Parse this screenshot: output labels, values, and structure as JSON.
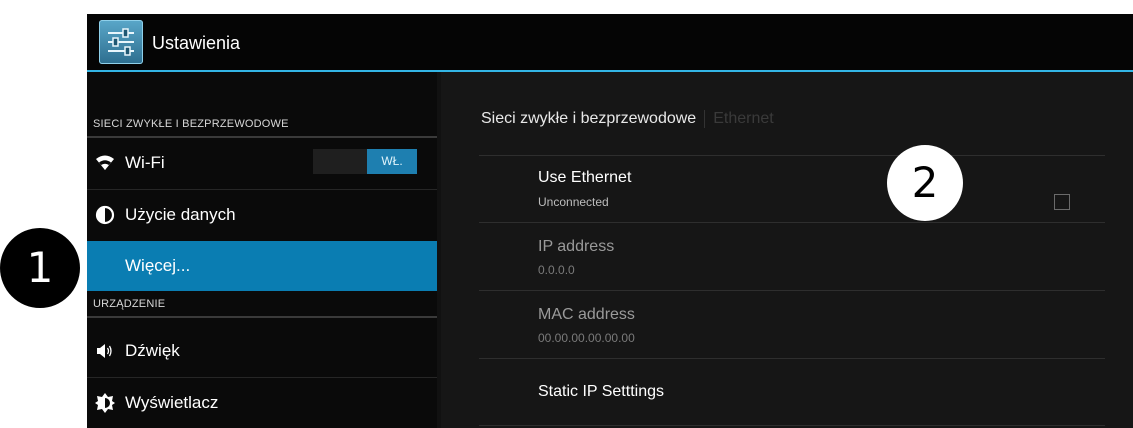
{
  "action_bar": {
    "title": "Ustawienia",
    "icon": "settings-sliders-icon"
  },
  "left_pane": {
    "sections": [
      {
        "header": "SIECI ZWYKŁE I BEZPRZEWODOWE",
        "items": [
          {
            "label": "Wi-Fi",
            "icon": "wifi-icon",
            "toggle": "WŁ."
          },
          {
            "label": "Użycie danych",
            "icon": "data-usage-icon"
          },
          {
            "label": "Więcej...",
            "icon": "",
            "selected": true
          }
        ]
      },
      {
        "header": "URZĄDZENIE",
        "items": [
          {
            "label": "Dźwięk",
            "icon": "speaker-icon"
          },
          {
            "label": "Wyświetlacz",
            "icon": "brightness-icon"
          }
        ]
      }
    ]
  },
  "right_pane": {
    "breadcrumb": {
      "parent": "Sieci zwykłe i bezprzewodowe",
      "current": "Ethernet"
    },
    "preferences": [
      {
        "title": "Use Ethernet",
        "summary": "Unconnected",
        "checked": false
      },
      {
        "title": "IP address",
        "summary": "0.0.0.0"
      },
      {
        "title": "MAC address",
        "summary": "00.00.00.00.00.00"
      },
      {
        "title": "Static IP Setttings",
        "summary": ""
      }
    ]
  },
  "callouts": {
    "one": "1",
    "two": "2"
  },
  "colors": {
    "accent": "#33b5e5",
    "selected": "#0a7db2"
  }
}
